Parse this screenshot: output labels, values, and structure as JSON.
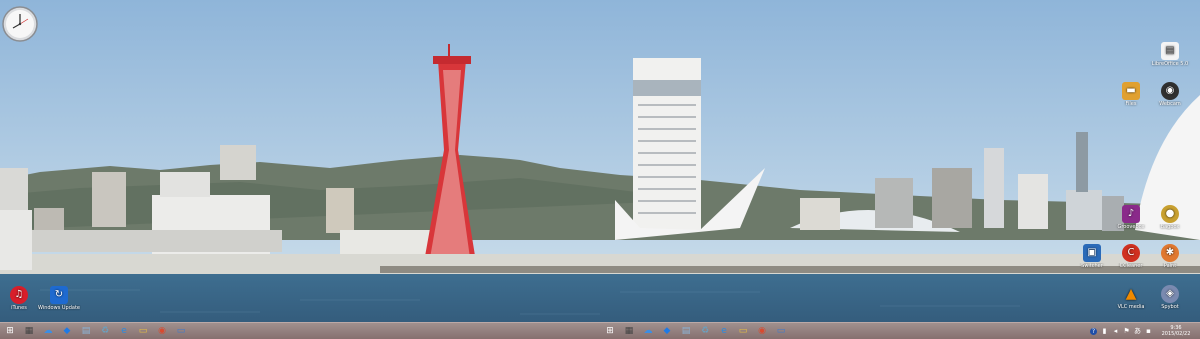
{
  "desktop": {
    "gadget": {
      "name": "clock-gadget"
    },
    "icons_right": [
      {
        "label": "LibreOffice 5.0",
        "icon": "document-icon",
        "color": "#f4f4f4"
      },
      {
        "label": "Files",
        "icon": "folder-icon",
        "color": "#e0a030"
      },
      {
        "label": "Webcam",
        "icon": "camera-icon",
        "color": "#303030"
      },
      {
        "label": "Groovebox",
        "icon": "music-icon",
        "color": "#8a2a8a"
      },
      {
        "label": "Bagbox",
        "icon": "bag-icon",
        "color": "#c8a030"
      },
      {
        "label": "Switcher",
        "icon": "switch-icon",
        "color": "#2a6ab8"
      },
      {
        "label": "CCleaner",
        "icon": "cleaner-icon",
        "color": "#d03020"
      },
      {
        "label": "Paint",
        "icon": "palette-icon",
        "color": "#e07830"
      },
      {
        "label": "VLC media",
        "icon": "vlc-icon",
        "color": "#f08a00"
      },
      {
        "label": "Spybot",
        "icon": "shield-icon",
        "color": "#7a8ab0"
      }
    ],
    "icons_left": [
      {
        "label": "iTunes",
        "icon": "music-note-icon",
        "color": "#d81e2a"
      },
      {
        "label": "Windows Update",
        "icon": "update-icon",
        "color": "#1e6ad0"
      }
    ]
  },
  "taskbar": {
    "left_buttons": [
      {
        "name": "start-button",
        "glyph": "⊞",
        "color": "#ffffff"
      },
      {
        "name": "store-icon",
        "glyph": "▦",
        "color": "#444444"
      },
      {
        "name": "onedrive-icon",
        "glyph": "☁",
        "color": "#3a8ee6"
      },
      {
        "name": "dropbox-icon",
        "glyph": "◆",
        "color": "#1e7ae6"
      },
      {
        "name": "notepad-icon",
        "glyph": "▤",
        "color": "#8ab4d8"
      },
      {
        "name": "recycle-icon",
        "glyph": "♻",
        "color": "#6aa0c0"
      },
      {
        "name": "ie-icon",
        "glyph": "e",
        "color": "#2a8ae0"
      },
      {
        "name": "explorer-icon",
        "glyph": "▭",
        "color": "#e8c040"
      },
      {
        "name": "chrome-icon",
        "glyph": "◉",
        "color": "#d84a30"
      },
      {
        "name": "desktop-icon",
        "glyph": "▭",
        "color": "#3a7ad0"
      }
    ],
    "tray": {
      "icons": [
        "help-icon",
        "network-icon",
        "volume-icon",
        "flag-icon",
        "input-icon",
        "power-icon"
      ],
      "time": "9:36",
      "date": "2015/02/22"
    }
  }
}
